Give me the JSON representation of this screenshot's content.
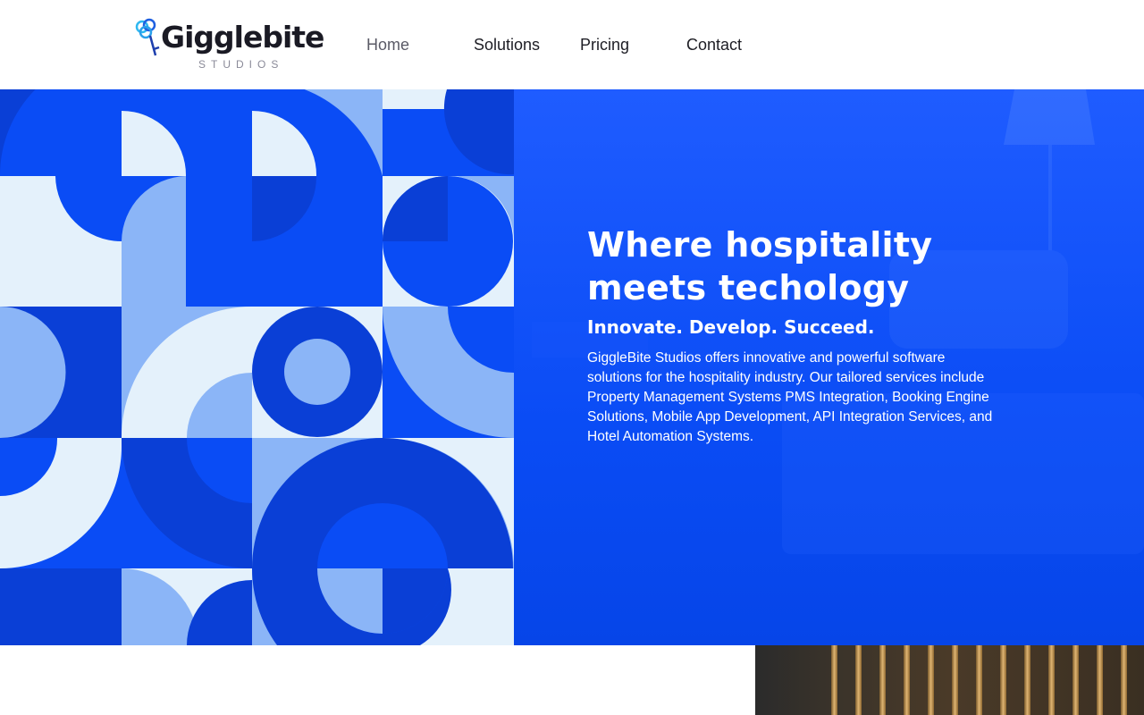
{
  "brand": {
    "name": "Gigglebite",
    "sub": "STUDIOS"
  },
  "nav": {
    "items": [
      {
        "label": "Home"
      },
      {
        "label": "Solutions"
      },
      {
        "label": "Pricing"
      },
      {
        "label": "Contact"
      }
    ]
  },
  "hero": {
    "title_line1": "Where hospitality",
    "title_line2": "meets techology",
    "tagline": "Innovate. Develop. Succeed.",
    "body": "GiggleBite Studios offers innovative and powerful software solutions for the hospitality industry. Our tailored services include Property Management Systems PMS Integration, Booking Engine Solutions, Mobile App Development, API Integration Services, and Hotel Automation Systems."
  },
  "colors": {
    "accent": "#0a4cf5",
    "pattern_dark": "#0a3fd6",
    "pattern_light": "#8bb5f7",
    "pattern_pale": "#e4f1fb"
  },
  "icons": {
    "logo": "key-logo-icon"
  }
}
